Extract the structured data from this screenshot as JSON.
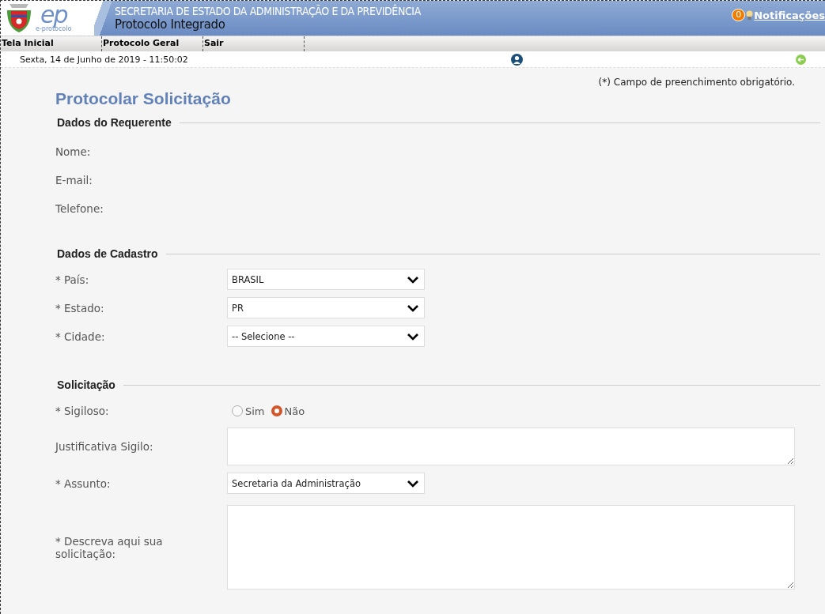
{
  "header": {
    "logo": {
      "mark": "ep",
      "caption": "e-protocolo"
    },
    "agency": "SECRETARIA DE ESTADO DA ADMINISTRAÇÃO E DA PREVIDÊNCIA",
    "system": "Protocolo Integrado",
    "notifications": {
      "count": "0",
      "label": "Notificações"
    }
  },
  "nav": [
    {
      "label": "Tela Inicial"
    },
    {
      "label": "Protocolo Geral"
    },
    {
      "label": "Sair"
    }
  ],
  "date_bar": {
    "date": "Sexta, 14 de Junho de 2019 - 11:50:02"
  },
  "note": "(*) Campo de preenchimento obrigatório.",
  "title": "Protocolar Solicitação",
  "sections": [
    {
      "title": "Dados do Requerente",
      "fields": [
        {
          "kind": "text",
          "label": "Nome:"
        },
        {
          "kind": "text",
          "label": "E-mail:"
        },
        {
          "kind": "text",
          "label": "Telefone:"
        }
      ]
    },
    {
      "title": "Dados de Cadastro",
      "fields": [
        {
          "kind": "select",
          "label": "* País:",
          "value": "BRASIL"
        },
        {
          "kind": "select",
          "label": "* Estado:",
          "value": "PR"
        },
        {
          "kind": "select",
          "label": "* Cidade:",
          "value": "-- Selecione --"
        }
      ]
    },
    {
      "title": "Solicitação",
      "fields": [
        {
          "kind": "radio",
          "label": "* Sigiloso:",
          "options": [
            {
              "label": "Sim",
              "selected": false
            },
            {
              "label": "Não",
              "selected": true
            }
          ]
        },
        {
          "kind": "textarea",
          "label": "Justificativa Sigilo:"
        },
        {
          "kind": "select",
          "label": "* Assunto:",
          "value": "Secretaria da Administração"
        },
        {
          "kind": "memo",
          "label": "* Descreva aqui sua solicitação:"
        }
      ]
    }
  ]
}
